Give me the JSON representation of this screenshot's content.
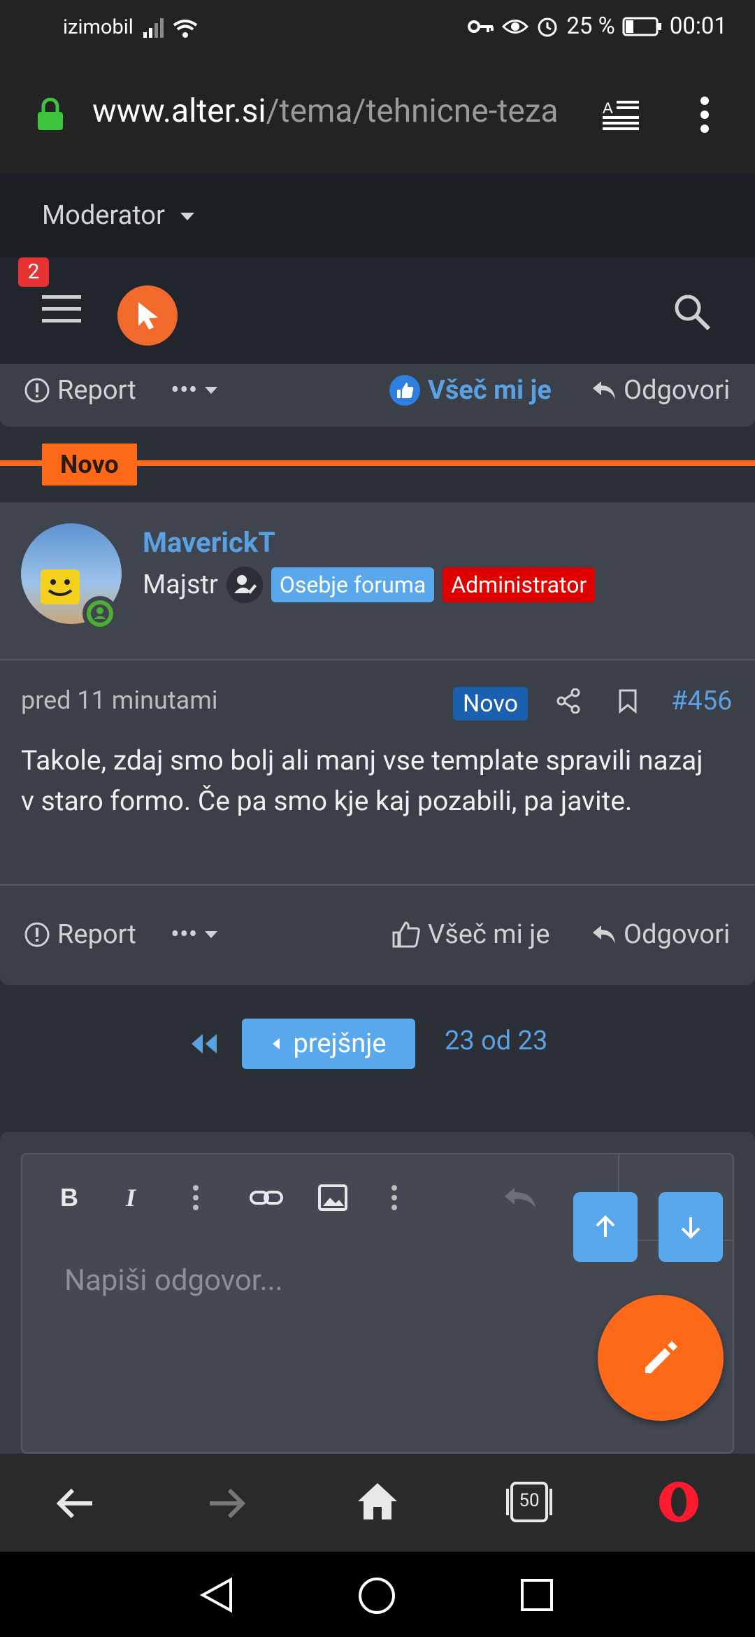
{
  "status": {
    "carrier": "izimobil",
    "battery": "25 %",
    "time": "00:01"
  },
  "browser": {
    "domain": "www.alter.si",
    "path": "/tema/tehnicne-teza"
  },
  "moderator": {
    "label": "Moderator"
  },
  "nav": {
    "notifications": "2"
  },
  "prev_post": {
    "report": "Report",
    "more": "•••",
    "like": "Všeč mi je",
    "reply": "Odgovori"
  },
  "divider": {
    "label": "Novo"
  },
  "post": {
    "author": "MaverickT",
    "rank": "Majstr",
    "badges": [
      "Osebje foruma",
      "Administrator"
    ],
    "time": "pred 11 minutami",
    "new_badge": "Novo",
    "number": "#456",
    "text": "Takole, zdaj smo bolj ali manj vse template spravili nazaj v staro formo. Če pa smo kje kaj pozabili, pa javite.",
    "report": "Report",
    "more": "•••",
    "like": "Všeč mi je",
    "reply": "Odgovori"
  },
  "pagination": {
    "prev": "prejšnje",
    "pages": "23 od 23"
  },
  "editor": {
    "placeholder": "Napiši odgovor..."
  },
  "tabs_count": "50",
  "colors": {
    "accent": "#ff6a1a",
    "link": "#5aa1e3",
    "admin": "#e00000",
    "staff": "#5aa8ec"
  }
}
